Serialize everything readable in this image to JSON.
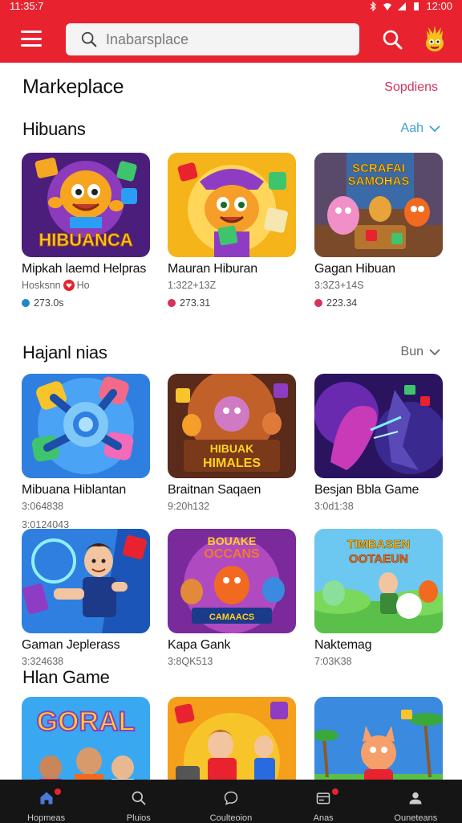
{
  "status_bar": {
    "time": "11:35:7",
    "right_time": "12:00"
  },
  "search": {
    "placeholder": "Inabarsplace"
  },
  "page": {
    "title": "Markeplace",
    "action": "Sopdiens"
  },
  "sections": [
    {
      "title": "Hibuans",
      "more": "Aah",
      "cards": [
        {
          "title": "Mipkah laemd Helpras",
          "subtitle_a": "Hosksnn",
          "subtitle_b": "Ho",
          "stat": "273.0s",
          "stat_color": "#1e88c8"
        },
        {
          "title": "Mauran Hiburan",
          "subtitle": "1:322+13Z",
          "stat": "273.31",
          "stat_color": "#d8315b"
        },
        {
          "title": "Gagan Hibuan",
          "subtitle": "3:3Z3+14S",
          "stat": "223.34",
          "stat_color": "#d8315b"
        }
      ]
    },
    {
      "title": "Hajanl nias",
      "more": "Bun",
      "cards": [
        {
          "title": "Mibuana Hiblantan",
          "subtitle": "3:064838",
          "subtitle2": "3:0124043"
        },
        {
          "title": "Braitnan Saqaen",
          "subtitle": "9:20h132"
        },
        {
          "title": "Besjan Bbla Game",
          "subtitle": "3:0d1:38"
        },
        {
          "title": "Gaman Jeplerass",
          "subtitle": "3:324638"
        },
        {
          "title": "Kapa Gank",
          "subtitle": "3:8QK513"
        },
        {
          "title": "Naktemag",
          "subtitle": "7:03K38"
        }
      ]
    },
    {
      "title": "Hlan Game"
    }
  ],
  "thumb_text": {
    "t1": "HIBUANCA",
    "t3a": "SCRAFAI",
    "t3b": "SAMOHAS",
    "t5a": "HIBUAK",
    "t5b": "HIMALES",
    "t8a": "BOUAKE",
    "t8b": "OCCANS",
    "t8c": "CAMAACS",
    "t9a": "TIMBASEN",
    "t9b": "OOTAEUN",
    "t10": "GORAL"
  },
  "bottom_nav": [
    {
      "label": "Hopmeas",
      "icon": "home-icon",
      "badge": true
    },
    {
      "label": "Pluios",
      "icon": "search-icon",
      "badge": false
    },
    {
      "label": "Coulteoion",
      "icon": "chat-icon",
      "badge": false
    },
    {
      "label": "Anas",
      "icon": "card-icon",
      "badge": true
    },
    {
      "label": "Ouneteans",
      "icon": "profile-icon",
      "badge": false
    }
  ],
  "colors": {
    "brand": "#e8232f",
    "accent": "#d8315b",
    "link": "#3b9fd8",
    "nav_bg": "#151515"
  }
}
